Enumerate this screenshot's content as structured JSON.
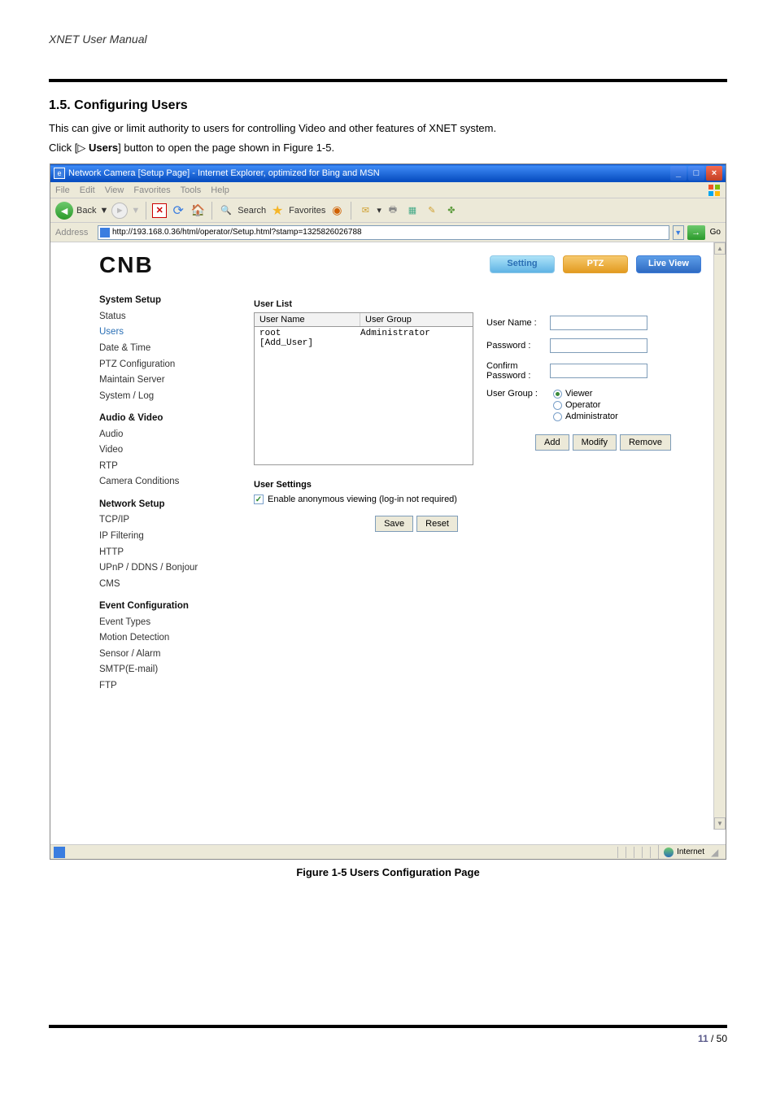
{
  "header": {
    "manual_title": "XNET User Manual"
  },
  "section": {
    "heading": "1.5. Configuring Users",
    "p1": "This can give or limit authority to users for controlling Video and other features of XNET system.",
    "p2_pre": "Click [",
    "p2_tri": "▷",
    "p2_bold": " Users",
    "p2_post": "] button to open the page shown in Figure 1-5."
  },
  "ie": {
    "title": "Network Camera [Setup Page] - Internet Explorer, optimized for Bing and MSN",
    "menus": [
      "File",
      "Edit",
      "View",
      "Favorites",
      "Tools",
      "Help"
    ],
    "toolbar": {
      "back": "Back",
      "search": "Search",
      "favorites": "Favorites"
    },
    "address_label": "Address",
    "url": "http://193.168.0.36/html/operator/Setup.html?stamp=1325826026788",
    "go_label": "Go",
    "status_internet": "Internet"
  },
  "content": {
    "logo": "CNB",
    "tabs": {
      "setting": "Setting",
      "ptz": "PTZ",
      "live": "Live View"
    },
    "sidebar": [
      {
        "title": "System Setup",
        "items_meta": [
          {
            "label": "Status",
            "active": false
          },
          {
            "label": "Users",
            "active": true
          },
          {
            "label": "Date & Time",
            "active": false
          },
          {
            "label": "PTZ Configuration",
            "active": false
          },
          {
            "label": "Maintain Server",
            "active": false
          },
          {
            "label": "System / Log",
            "active": false
          }
        ]
      },
      {
        "title": "Audio & Video",
        "items_meta": [
          {
            "label": "Audio",
            "active": false
          },
          {
            "label": "Video",
            "active": false
          },
          {
            "label": "RTP",
            "active": false
          },
          {
            "label": "Camera Conditions",
            "active": false
          }
        ]
      },
      {
        "title": "Network Setup",
        "items_meta": [
          {
            "label": "TCP/IP",
            "active": false
          },
          {
            "label": "IP Filtering",
            "active": false
          },
          {
            "label": "HTTP",
            "active": false
          },
          {
            "label": "UPnP / DDNS / Bonjour",
            "active": false
          },
          {
            "label": "CMS",
            "active": false
          }
        ]
      },
      {
        "title": "Event Configuration",
        "items_meta": [
          {
            "label": "Event Types",
            "active": false
          },
          {
            "label": "Motion Detection",
            "active": false
          },
          {
            "label": "Sensor / Alarm",
            "active": false
          },
          {
            "label": "SMTP(E-mail)",
            "active": false
          },
          {
            "label": "FTP",
            "active": false
          }
        ]
      }
    ],
    "userlist": {
      "title": "User List",
      "h_name": "User Name",
      "h_group": "User Group",
      "rows": [
        {
          "name": "root",
          "group": "Administrator"
        },
        {
          "name": "[Add_User]",
          "group": ""
        }
      ]
    },
    "form": {
      "username": "User Name :",
      "password": "Password :",
      "confirm1": "Confirm",
      "confirm2": "Password :",
      "usergroup": "User Group :",
      "viewer": "Viewer",
      "operator": "Operator",
      "admin": "Administrator",
      "btn_add": "Add",
      "btn_modify": "Modify",
      "btn_remove": "Remove"
    },
    "settings": {
      "title": "User Settings",
      "anon": "Enable anonymous viewing (log-in not required)",
      "save": "Save",
      "reset": "Reset"
    }
  },
  "figure_caption": "Figure 1-5 Users Configuration Page",
  "page_number": {
    "current": "11",
    "sep": " / ",
    "total": "50"
  }
}
